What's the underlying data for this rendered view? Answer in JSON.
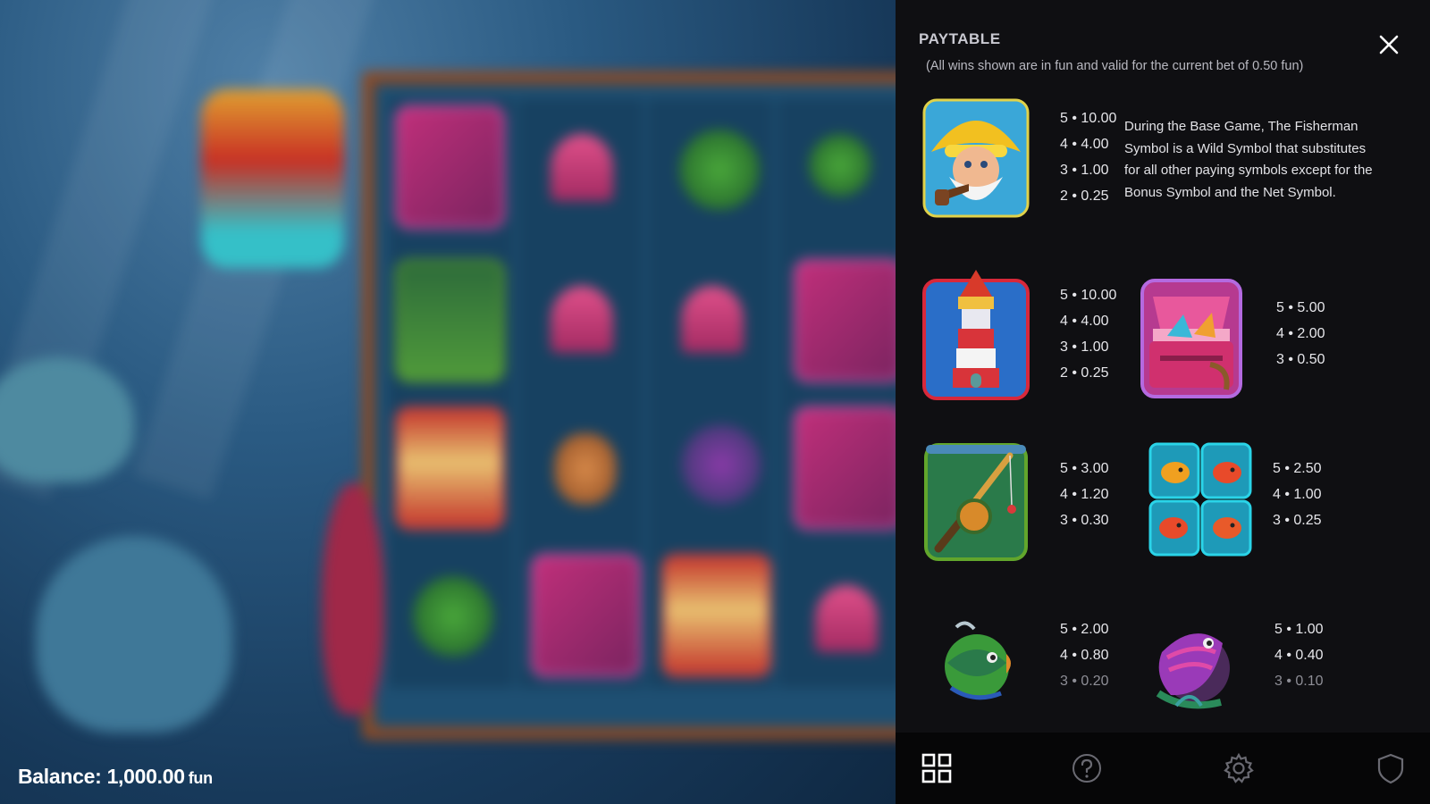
{
  "balance": {
    "label": "Balance: 1,000.00",
    "unit": "fun"
  },
  "paytable": {
    "title": "PAYTABLE",
    "subtitle": "(All wins shown are in fun and valid for the current bet of 0.50 fun)",
    "close_icon": "close-icon",
    "wild_description": "During the Base Game, The Fisherman Symbol is a Wild Symbol that substitutes for all other paying symbols except for the Bonus Symbol and the Net Symbol.",
    "symbols": {
      "fisherman": {
        "icon": "fisherman-icon",
        "pays": [
          "5 • 10.00",
          "4 • 4.00",
          "3 •  1.00",
          "2 • 0.25"
        ]
      },
      "lighthouse": {
        "icon": "lighthouse-icon",
        "pays": [
          "5 • 10.00",
          "4 • 4.00",
          "3 •  1.00",
          "2 • 0.25"
        ]
      },
      "tackle_box": {
        "icon": "tackle-box-icon",
        "pays": [
          "5 • 5.00",
          "4 • 2.00",
          "3 • 0.50"
        ]
      },
      "fishing_rod": {
        "icon": "fishing-rod-icon",
        "pays": [
          "5 • 3.00",
          "4 • 1.20",
          "3 • 0.30"
        ]
      },
      "goldfish": {
        "icon": "goldfish-icon",
        "pays": [
          "5 • 2.50",
          "4 • 1.00",
          "3 • 0.25"
        ]
      },
      "green_fish": {
        "icon": "green-fish-icon",
        "pays": [
          "5 • 2.00",
          "4 • 0.80",
          "3 • 0.20"
        ]
      },
      "purple_fish": {
        "icon": "purple-fish-icon",
        "pays": [
          "5 •  1.00",
          "4 • 0.40",
          "3 • 0.10"
        ]
      }
    }
  },
  "nav": {
    "items": [
      {
        "icon": "grid-icon"
      },
      {
        "icon": "help-icon"
      },
      {
        "icon": "settings-icon"
      },
      {
        "icon": "shield-icon"
      }
    ]
  },
  "colors": {
    "panel_bg": "#0f0f12",
    "nav_bg": "#060607",
    "text": "#e6e6ea",
    "dim_text": "#8e8e96"
  }
}
